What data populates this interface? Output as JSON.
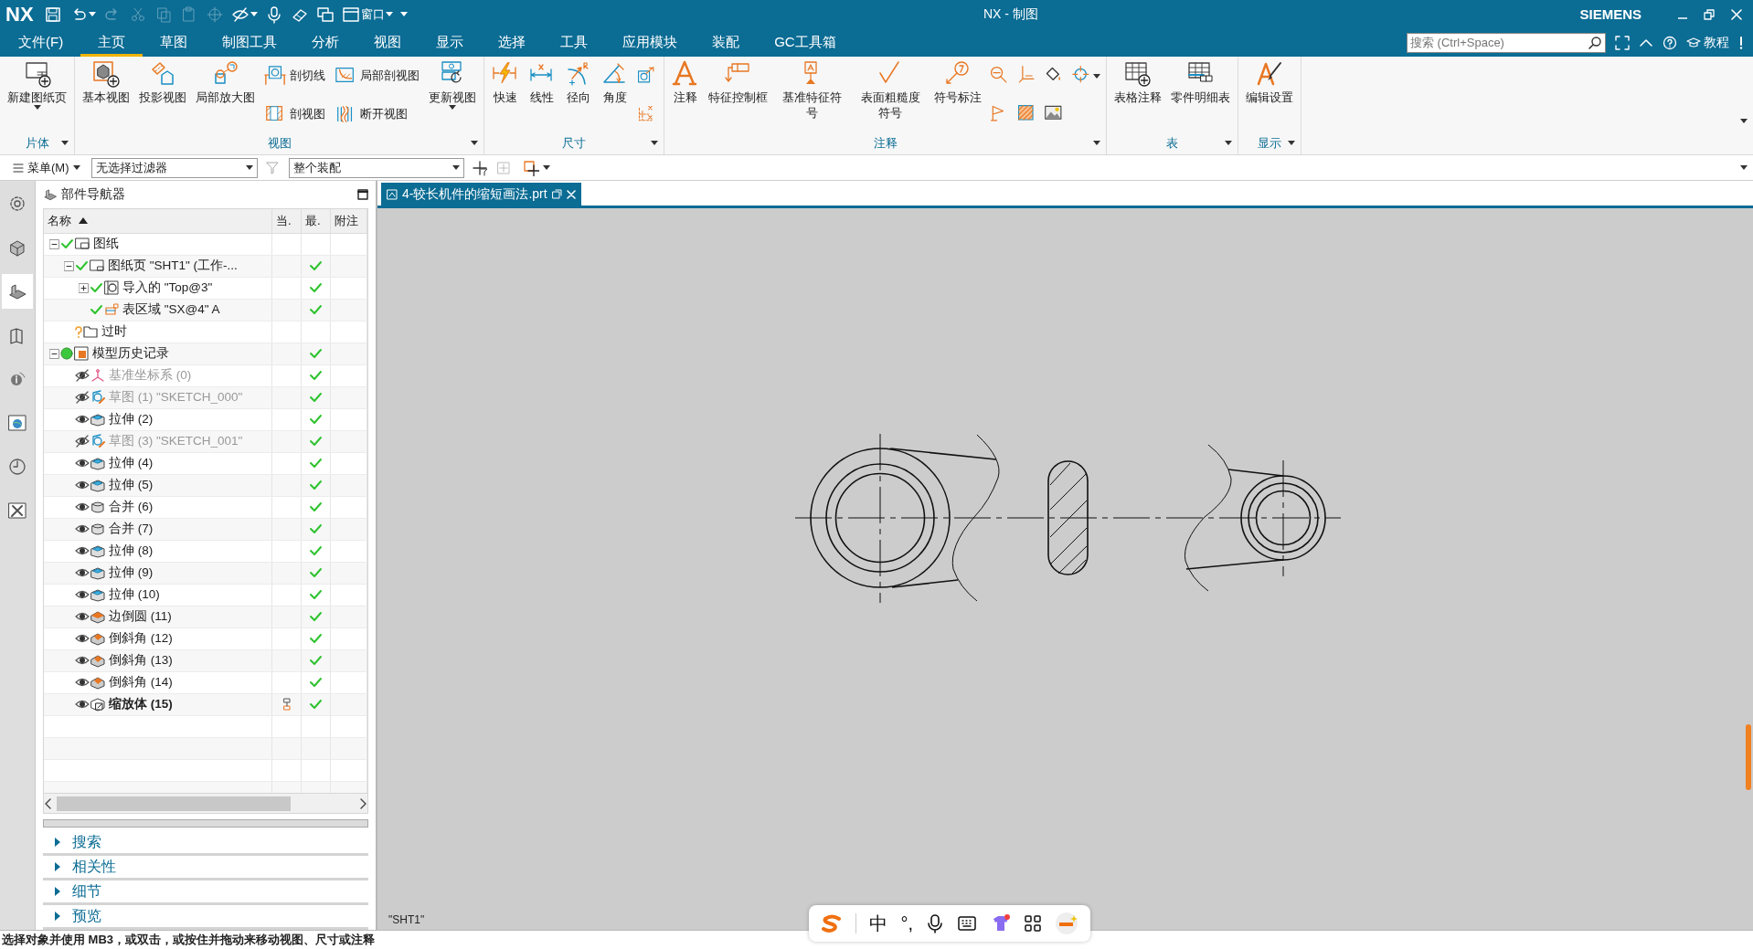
{
  "title_bar": {
    "logo": "NX",
    "title": "NX - 制图",
    "brand": "SIEMENS",
    "quick_access": [
      {
        "kind": "save",
        "disabled": false,
        "dropdown": false
      },
      {
        "kind": "undo",
        "disabled": false,
        "dropdown": true
      },
      {
        "kind": "redo",
        "disabled": true,
        "dropdown": false
      },
      {
        "kind": "cut",
        "disabled": true,
        "dropdown": false
      },
      {
        "kind": "copy",
        "disabled": true,
        "dropdown": false
      },
      {
        "kind": "paste",
        "disabled": true,
        "dropdown": false
      },
      {
        "kind": "snap",
        "disabled": true,
        "dropdown": false
      },
      {
        "kind": "hide",
        "disabled": false,
        "dropdown": true
      },
      {
        "kind": "mic",
        "disabled": false,
        "dropdown": false
      },
      {
        "kind": "eraser",
        "disabled": false,
        "dropdown": false
      },
      {
        "kind": "windows",
        "disabled": false,
        "dropdown": false
      },
      {
        "kind": "window-menu",
        "label": "窗口",
        "disabled": false,
        "dropdown": true
      },
      {
        "kind": "more",
        "disabled": false,
        "dropdown": true
      }
    ]
  },
  "menu_bar": {
    "items": [
      {
        "label": "文件(F)",
        "selected": false
      },
      {
        "label": "主页",
        "selected": true
      },
      {
        "label": "草图",
        "selected": false
      },
      {
        "label": "制图工具",
        "selected": false
      },
      {
        "label": "分析",
        "selected": false
      },
      {
        "label": "视图",
        "selected": false
      },
      {
        "label": "显示",
        "selected": false
      },
      {
        "label": "选择",
        "selected": false
      },
      {
        "label": "工具",
        "selected": false
      },
      {
        "label": "应用模块",
        "selected": false
      },
      {
        "label": "装配",
        "selected": false
      },
      {
        "label": "GC工具箱",
        "selected": false
      }
    ],
    "search": {
      "placeholder": "搜索 (Ctrl+Space)"
    },
    "help": "教程"
  },
  "ribbon": {
    "groups": [
      {
        "label": "片体",
        "items": [
          {
            "kind": "large",
            "label": "新建图纸页",
            "dropdown": true
          }
        ]
      },
      {
        "label": "视图",
        "items": [
          {
            "kind": "large",
            "label": "基本视图",
            "dropdown": false
          },
          {
            "kind": "large",
            "label": "投影视图",
            "dropdown": false
          },
          {
            "kind": "large",
            "label": "局部放大图",
            "dropdown": false
          },
          {
            "kind": "small",
            "label": "剖切线",
            "dropdown": false
          },
          {
            "kind": "small",
            "label": "剖视图",
            "dropdown": false
          },
          {
            "kind": "small",
            "label": "局部剖视图",
            "dropdown": false
          },
          {
            "kind": "small",
            "label": "断开视图",
            "dropdown": false
          },
          {
            "kind": "large",
            "label": "更新视图",
            "dropdown": true
          }
        ]
      },
      {
        "label": "尺寸",
        "items": [
          {
            "kind": "large",
            "label": "快速",
            "dropdown": false
          },
          {
            "kind": "large",
            "label": "线性",
            "dropdown": false
          },
          {
            "kind": "large",
            "label": "径向",
            "dropdown": false
          },
          {
            "kind": "large",
            "label": "角度",
            "dropdown": false
          },
          {
            "kind": "icon",
            "dropdown": false
          },
          {
            "kind": "icon",
            "dropdown": false
          }
        ]
      },
      {
        "label": "注释",
        "items": [
          {
            "kind": "large",
            "label": "注释",
            "dropdown": false
          },
          {
            "kind": "large",
            "label": "特征控制框",
            "dropdown": false
          },
          {
            "kind": "large",
            "label": "基准特征符号",
            "dropdown": false
          },
          {
            "kind": "large",
            "label": "表面粗糙度符号",
            "dropdown": false
          },
          {
            "kind": "large",
            "label": "符号标注",
            "dropdown": false
          },
          {
            "kind": "icon",
            "dropdown": false
          },
          {
            "kind": "icon",
            "dropdown": false
          },
          {
            "kind": "icon",
            "dropdown": false
          },
          {
            "kind": "icon",
            "dropdown": false
          },
          {
            "kind": "icon",
            "dropdown": false
          },
          {
            "kind": "icon",
            "dropdown": false
          },
          {
            "kind": "icon",
            "dropdown": true
          }
        ]
      },
      {
        "label": "表",
        "items": [
          {
            "kind": "large",
            "label": "表格注释",
            "dropdown": false
          },
          {
            "kind": "large",
            "label": "零件明细表",
            "dropdown": false
          }
        ]
      },
      {
        "label": "显示",
        "items": [
          {
            "kind": "large",
            "label": "编辑设置",
            "dropdown": false
          }
        ]
      }
    ]
  },
  "selection_bar": {
    "menu": "菜单(M)",
    "filter": "无选择过滤器",
    "scope": "整个装配"
  },
  "resource_bar": [
    {
      "kind": "settings",
      "selected": false
    },
    {
      "kind": "assembly",
      "selected": false
    },
    {
      "kind": "part",
      "selected": true
    },
    {
      "kind": "reuse",
      "selected": false
    },
    {
      "kind": "info",
      "selected": false
    },
    {
      "kind": "web",
      "selected": false
    },
    {
      "kind": "history",
      "selected": false
    },
    {
      "kind": "tools",
      "selected": false
    }
  ],
  "navigator": {
    "title": "部件导航器",
    "columns": [
      "名称",
      "当.",
      "最.",
      "附注"
    ],
    "tree": [
      {
        "label": "图纸",
        "kind": "drawing",
        "up_to_date": true,
        "expanded": true,
        "latest": false,
        "children": [
          {
            "label": "图纸页 \"SHT1\" (工作-...",
            "kind": "sheet",
            "up_to_date": true,
            "expanded": true,
            "latest": true,
            "children": [
              {
                "label": "导入的 \"Top@3\"",
                "kind": "view",
                "up_to_date": true,
                "expanded": false,
                "latest": true
              },
              {
                "label": "表区域 \"SX@4\" A",
                "kind": "table-region",
                "up_to_date": true,
                "latest": true
              }
            ]
          },
          {
            "label": "过时",
            "kind": "folder",
            "up_to_date": false,
            "latest": false
          }
        ]
      },
      {
        "label": "模型历史记录",
        "kind": "history",
        "up_to_date": true,
        "expanded": true,
        "latest": true,
        "children": [
          {
            "label": "基准坐标系 (0)",
            "kind": "datum",
            "visible": false,
            "current": false,
            "latest": true
          },
          {
            "label": "草图 (1) \"SKETCH_000\"",
            "kind": "sketch",
            "visible": false,
            "current": false,
            "latest": true
          },
          {
            "label": "拉伸 (2)",
            "kind": "extrude",
            "visible": true,
            "current": false,
            "latest": true
          },
          {
            "label": "草图 (3) \"SKETCH_001\"",
            "kind": "sketch",
            "visible": false,
            "current": false,
            "latest": true
          },
          {
            "label": "拉伸 (4)",
            "kind": "extrude",
            "visible": true,
            "current": false,
            "latest": true
          },
          {
            "label": "拉伸 (5)",
            "kind": "extrude",
            "visible": true,
            "current": false,
            "latest": true
          },
          {
            "label": "合并 (6)",
            "kind": "unite",
            "visible": true,
            "current": false,
            "latest": true
          },
          {
            "label": "合并 (7)",
            "kind": "unite",
            "visible": true,
            "current": false,
            "latest": true
          },
          {
            "label": "拉伸 (8)",
            "kind": "extrude",
            "visible": true,
            "current": false,
            "latest": true
          },
          {
            "label": "拉伸 (9)",
            "kind": "extrude",
            "visible": true,
            "current": false,
            "latest": true
          },
          {
            "label": "拉伸 (10)",
            "kind": "extrude",
            "visible": true,
            "current": false,
            "latest": true
          },
          {
            "label": "边倒圆 (11)",
            "kind": "blend",
            "visible": true,
            "current": false,
            "latest": true
          },
          {
            "label": "倒斜角 (12)",
            "kind": "chamfer",
            "visible": true,
            "current": false,
            "latest": true
          },
          {
            "label": "倒斜角 (13)",
            "kind": "chamfer",
            "visible": true,
            "current": false,
            "latest": true
          },
          {
            "label": "倒斜角 (14)",
            "kind": "chamfer",
            "visible": true,
            "current": false,
            "latest": true
          },
          {
            "label": "缩放体 (15)",
            "kind": "scale",
            "visible": true,
            "current": true,
            "latest": true
          }
        ]
      }
    ],
    "panels": [
      {
        "label": "搜索",
        "expanded": false
      },
      {
        "label": "相关性",
        "expanded": false
      },
      {
        "label": "细节",
        "expanded": false
      },
      {
        "label": "预览",
        "expanded": false
      }
    ]
  },
  "document_tab": {
    "label": "4-较长机件的缩短画法.prt",
    "selected": true
  },
  "canvas": {
    "sheet_label": "\"SHT1\""
  },
  "ime_bar": {
    "language": "中",
    "punctuation": "°,"
  },
  "status_bar": {
    "message": "选择对象并使用 MB3，或双击，或按住并拖动来移动视图、尺寸或注释"
  }
}
